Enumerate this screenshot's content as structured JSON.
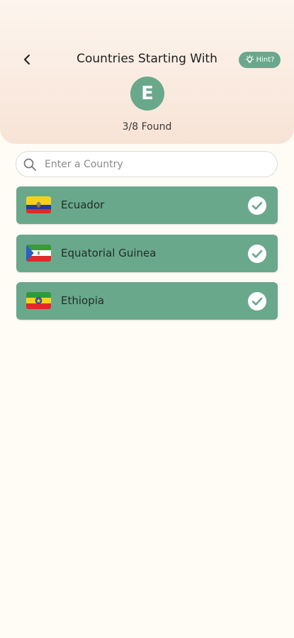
{
  "header": {
    "title": "Countries Starting With",
    "hint_label": "Hint?",
    "letter": "E",
    "found_text": "3/8 Found"
  },
  "search": {
    "placeholder": "Enter a Country",
    "value": ""
  },
  "countries": [
    {
      "name": "Ecuador"
    },
    {
      "name": "Equatorial Guinea"
    },
    {
      "name": "Ethiopia"
    }
  ],
  "colors": {
    "accent": "#6aa88b",
    "background": "#fffcf6",
    "header_gradient_top": "#fdf5ee",
    "header_gradient_bottom": "#f7e3d6"
  },
  "icons": {
    "back": "chevron-left-icon",
    "hint": "lightbulb-icon",
    "search": "search-icon",
    "check": "check-circle-icon"
  }
}
